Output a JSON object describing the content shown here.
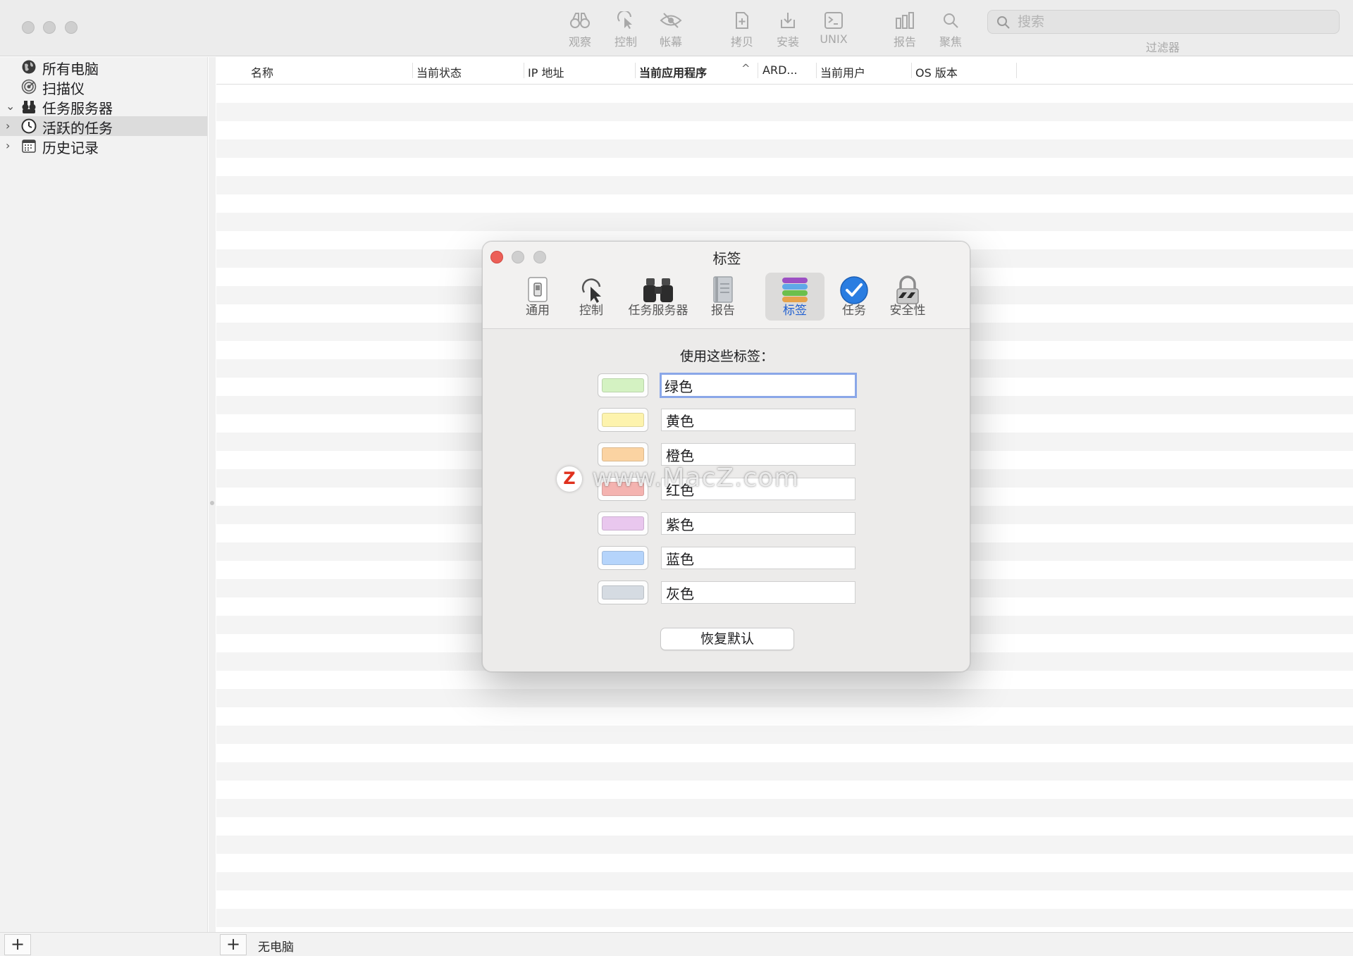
{
  "toolbar": {
    "tools": [
      {
        "id": "observe",
        "label": "观察",
        "icon": "binoculars-icon"
      },
      {
        "id": "control",
        "label": "控制",
        "icon": "pointer-icon"
      },
      {
        "id": "curtain",
        "label": "帐幕",
        "icon": "eye-slash-icon"
      },
      {
        "id": "copy",
        "label": "拷贝",
        "icon": "doc-plus-icon"
      },
      {
        "id": "install",
        "label": "安装",
        "icon": "install-icon"
      },
      {
        "id": "unix",
        "label": "UNIX",
        "icon": "terminal-icon"
      },
      {
        "id": "report",
        "label": "报告",
        "icon": "bar-chart-icon"
      },
      {
        "id": "spotlight",
        "label": "聚焦",
        "icon": "magnifier-icon"
      }
    ],
    "search_placeholder": "搜索",
    "filter_label": "过滤器"
  },
  "sidebar": {
    "items": [
      {
        "label": "所有电脑",
        "icon": "globe-icon",
        "disclosure": "",
        "selected": false
      },
      {
        "label": "扫描仪",
        "icon": "radar-icon",
        "disclosure": "",
        "selected": false
      },
      {
        "label": "任务服务器",
        "icon": "server-icon",
        "disclosure": "⌄",
        "selected": false
      },
      {
        "label": "活跃的任务",
        "icon": "clock-icon",
        "disclosure": "›",
        "selected": true
      },
      {
        "label": "历史记录",
        "icon": "calendar-icon",
        "disclosure": "›",
        "selected": false
      }
    ]
  },
  "table": {
    "columns": [
      "名称",
      "当前状态",
      "IP 地址",
      "当前应用程序",
      "ARD...",
      "当前用户",
      "OS 版本"
    ],
    "sorted_column": "当前应用程序",
    "sort_indicator": "^"
  },
  "bottombar": {
    "add_symbol": "+",
    "status": "无电脑"
  },
  "dialog": {
    "title": "标签",
    "tabs": [
      {
        "label": "通用",
        "icon": "switch-icon",
        "active": false
      },
      {
        "label": "控制",
        "icon": "pointer-icon",
        "active": false
      },
      {
        "label": "任务服务器",
        "icon": "binoculars-icon",
        "active": false
      },
      {
        "label": "报告",
        "icon": "notebook-icon",
        "active": false
      },
      {
        "label": "标签",
        "icon": "label-stack-icon",
        "active": true
      },
      {
        "label": "任务",
        "icon": "checkmark-icon",
        "active": false
      },
      {
        "label": "安全性",
        "icon": "lock-icon",
        "active": false
      }
    ],
    "heading": "使用这些标签：",
    "labels": [
      {
        "name": "绿色",
        "color": "#d4f2c2"
      },
      {
        "name": "黄色",
        "color": "#fdf3ad"
      },
      {
        "name": "橙色",
        "color": "#fbd3a2"
      },
      {
        "name": "红色",
        "color": "#f4b3b0"
      },
      {
        "name": "紫色",
        "color": "#e9c7ee"
      },
      {
        "name": "蓝色",
        "color": "#b5d4fb"
      },
      {
        "name": "灰色",
        "color": "#d5dbe2"
      }
    ],
    "restore_button": "恢复默认"
  },
  "watermark": {
    "logo_letter": "Z",
    "text": "www.MacZ.com"
  },
  "colors": {
    "close_red": "#ec5f57",
    "selection_blue": "#8aa7e8",
    "active_tab_text": "#1f5fd1"
  }
}
